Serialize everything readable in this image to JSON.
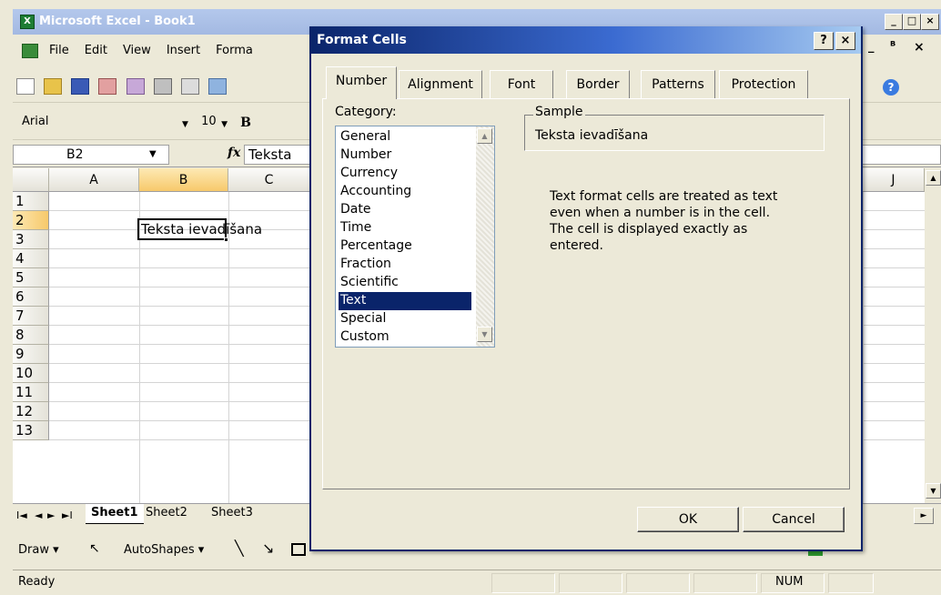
{
  "app": {
    "title": "Microsoft Excel - Book1",
    "title_icon": "excel-icon",
    "window_buttons": [
      "_",
      "□",
      "×"
    ],
    "menu": [
      "File",
      "Edit",
      "View",
      "Insert",
      "Forma"
    ],
    "doc_buttons": [
      "_",
      "ᴮ",
      "×"
    ]
  },
  "format_toolbar": {
    "font": "Arial",
    "size": "10",
    "bold_label": "B"
  },
  "formula_bar": {
    "name_box": "B2",
    "fx_label": "fx",
    "value": "Teksta"
  },
  "grid": {
    "columns": [
      "A",
      "B",
      "C",
      "J"
    ],
    "rows": [
      "1",
      "2",
      "3",
      "4",
      "5",
      "6",
      "7",
      "8",
      "9",
      "10",
      "11",
      "12",
      "13"
    ],
    "selected_column": "B",
    "selected_row": "2",
    "cell_b2": "Teksta ievadīšana"
  },
  "sheets": {
    "tabs": [
      "Sheet1",
      "Sheet2",
      "Sheet3"
    ],
    "active": "Sheet1",
    "nav": [
      "I◄",
      "◄",
      "►",
      "►I"
    ]
  },
  "drawing_toolbar": {
    "draw": "Draw ▾",
    "autoshapes": "AutoShapes ▾"
  },
  "status_bar": {
    "left": "Ready",
    "num": "NUM"
  },
  "dialog": {
    "title": "Format Cells",
    "help_button": "?",
    "close_button": "×",
    "tabs": [
      "Number",
      "Alignment",
      "Font",
      "Border",
      "Patterns",
      "Protection"
    ],
    "active_tab": "Number",
    "category_label": "Category:",
    "categories": [
      "General",
      "Number",
      "Currency",
      "Accounting",
      "Date",
      "Time",
      "Percentage",
      "Fraction",
      "Scientific",
      "Text",
      "Special",
      "Custom"
    ],
    "selected_category": "Text",
    "sample_label": "Sample",
    "sample_value": "Teksta ievadīšana",
    "description": "Text format cells are treated as text even when a number is in the cell.  The cell is displayed exactly as entered.",
    "ok": "OK",
    "cancel": "Cancel"
  },
  "colors": {
    "dialog_title": "#0a246a",
    "selection": "#0a246a",
    "app_title": "#a3b9e2",
    "selected_header": "#f7c96b"
  }
}
